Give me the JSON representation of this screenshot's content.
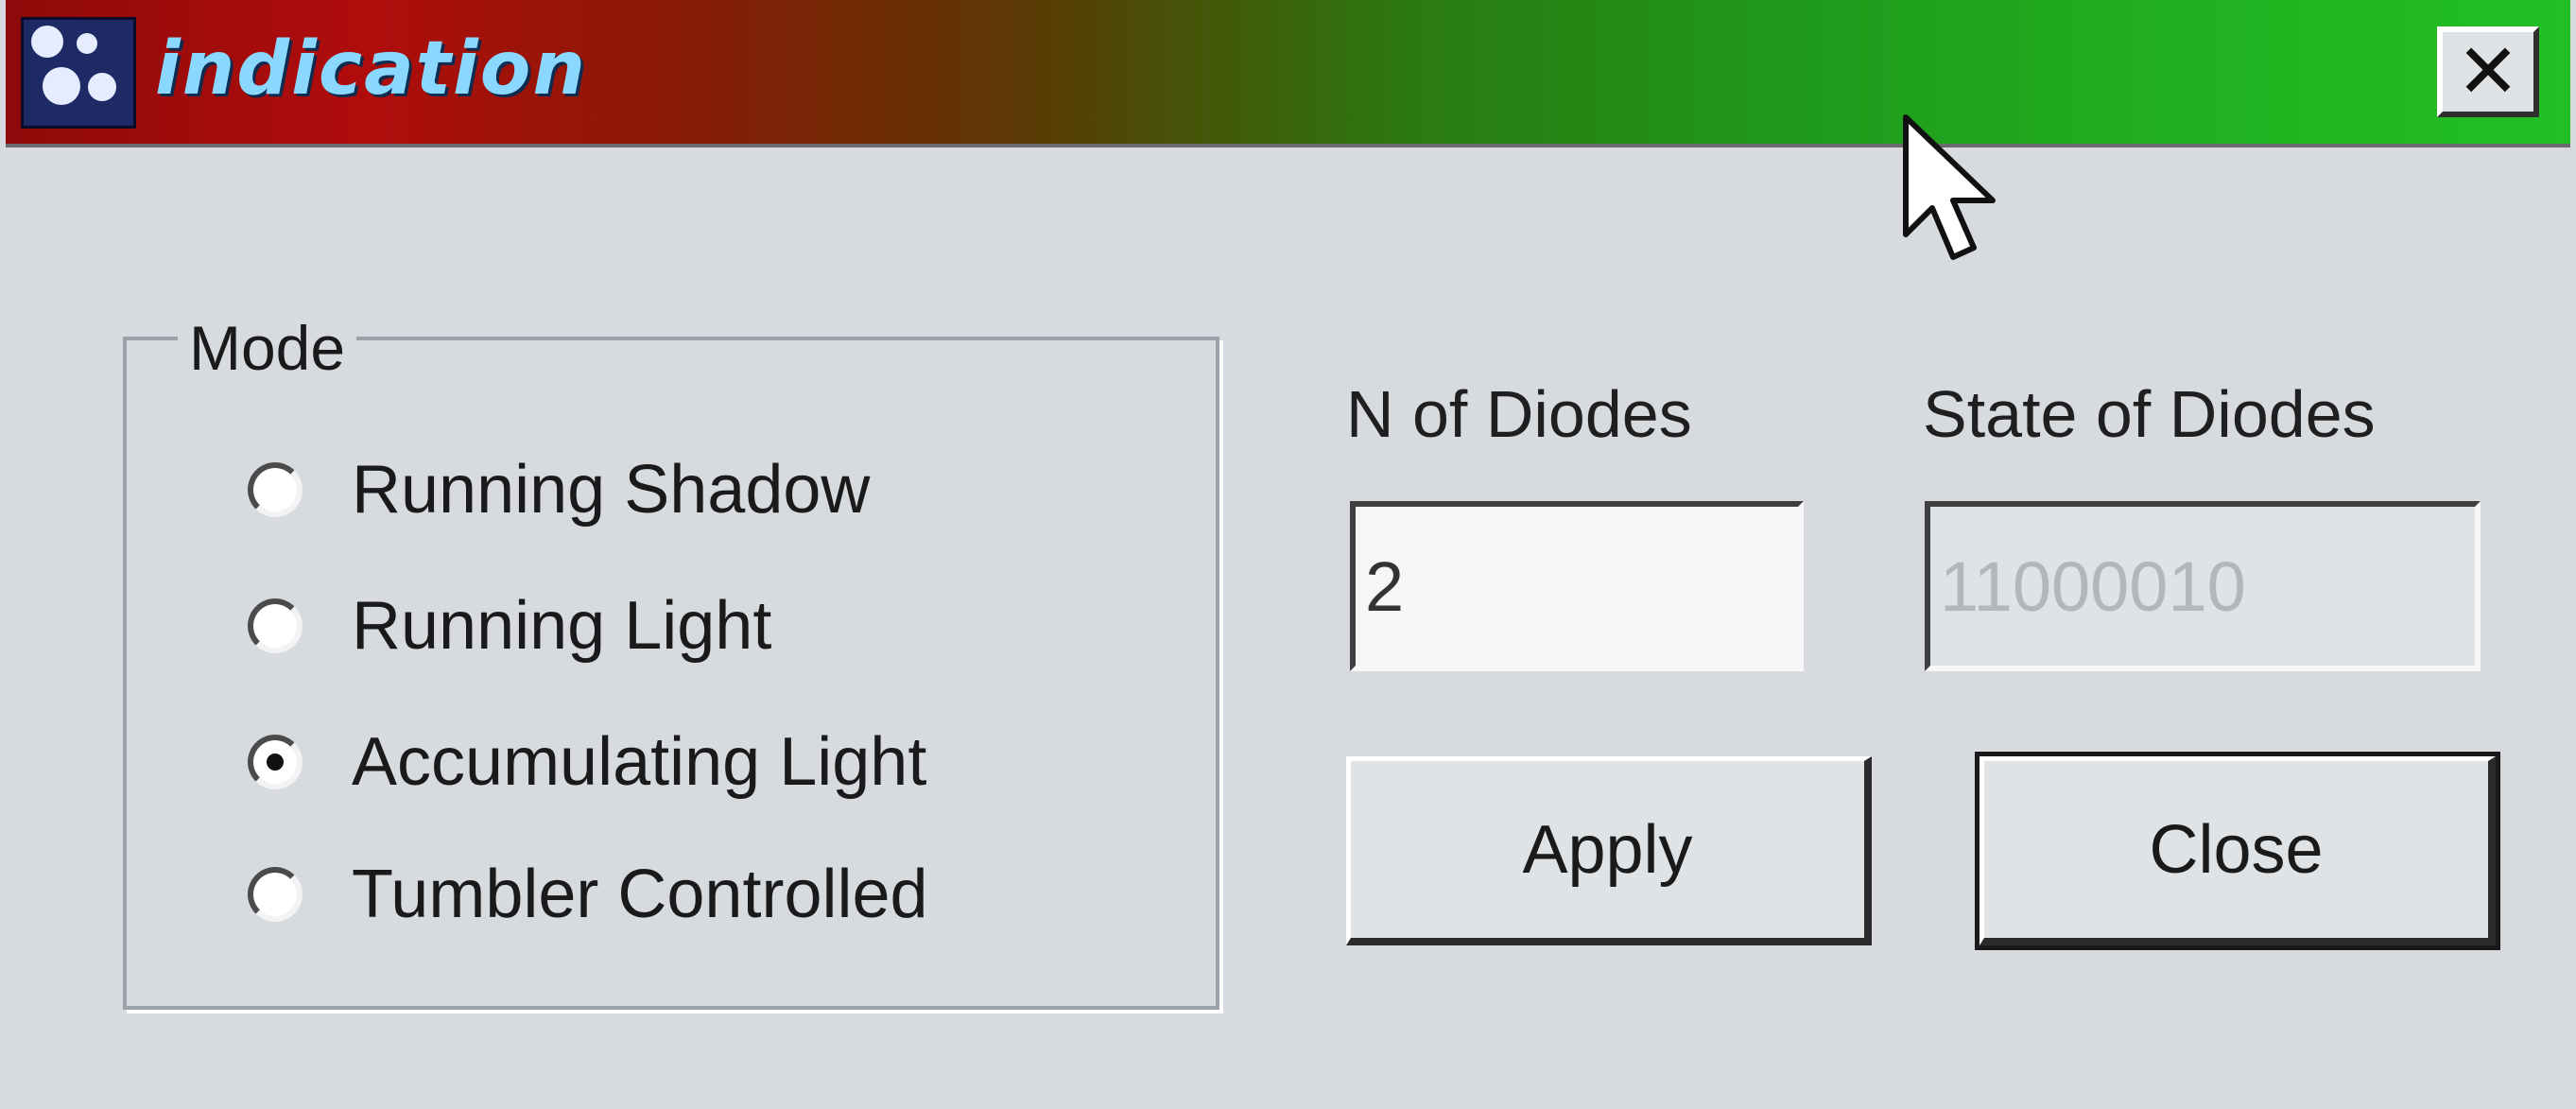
{
  "window": {
    "title": "indication",
    "close_glyph": "✕"
  },
  "mode_group": {
    "label": "Mode",
    "options": [
      {
        "label": "Running Shadow",
        "checked": false
      },
      {
        "label": "Running Light",
        "checked": false
      },
      {
        "label": "Accumulating Light",
        "checked": true
      },
      {
        "label": "Tumbler Controlled",
        "checked": false
      }
    ]
  },
  "n_of_diodes": {
    "label": "N of Diodes",
    "value": "2"
  },
  "state_of_diodes": {
    "label": "State of Diodes",
    "value": "11000010"
  },
  "buttons": {
    "apply": "Apply",
    "close": "Close"
  },
  "icons": {
    "app": "app-icon",
    "close": "close-icon",
    "cursor": "mouse-pointer-icon"
  }
}
